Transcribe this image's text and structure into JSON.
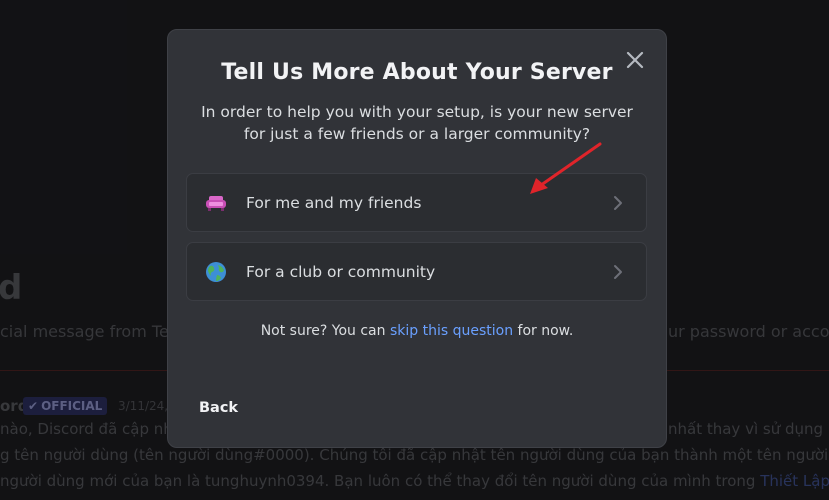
{
  "background": {
    "title": "d",
    "desc_left": "cial message from Tea",
    "desc_right": "ur password or accou",
    "author": "ord",
    "badge": "OFFICIAL",
    "date": "3/11/24,",
    "lines": [
      {
        "left": "nào, Discord đã cập nh",
        "right": "nhất thay vì sử dụng ký"
      },
      {
        "text": "g tên người dùng (tên người dùng#0000). Chúng tôi đã cập nhật tên người dùng của bạn thành một tên người d"
      },
      {
        "text": "người dùng mới của bạn là tunghuynh0394. Bạn luôn có thể thay đổi tên người dùng của mình trong ",
        "link": "Thiết Lập N"
      }
    ]
  },
  "modal": {
    "title": "Tell Us More About Your Server",
    "subtitle": "In order to help you with your setup, is your new server for just a few friends or a larger community?",
    "options": [
      {
        "label": "For me and my friends",
        "icon": "couch-icon"
      },
      {
        "label": "For a club or community",
        "icon": "globe-icon"
      }
    ],
    "hint_prefix": "Not sure? You can ",
    "hint_link": "skip this question",
    "hint_suffix": " for now.",
    "back_label": "Back"
  },
  "colors": {
    "modal_bg": "#313338",
    "option_bg": "#2b2d31",
    "link": "#6aa0ff",
    "annotation_arrow": "#e0242a"
  }
}
